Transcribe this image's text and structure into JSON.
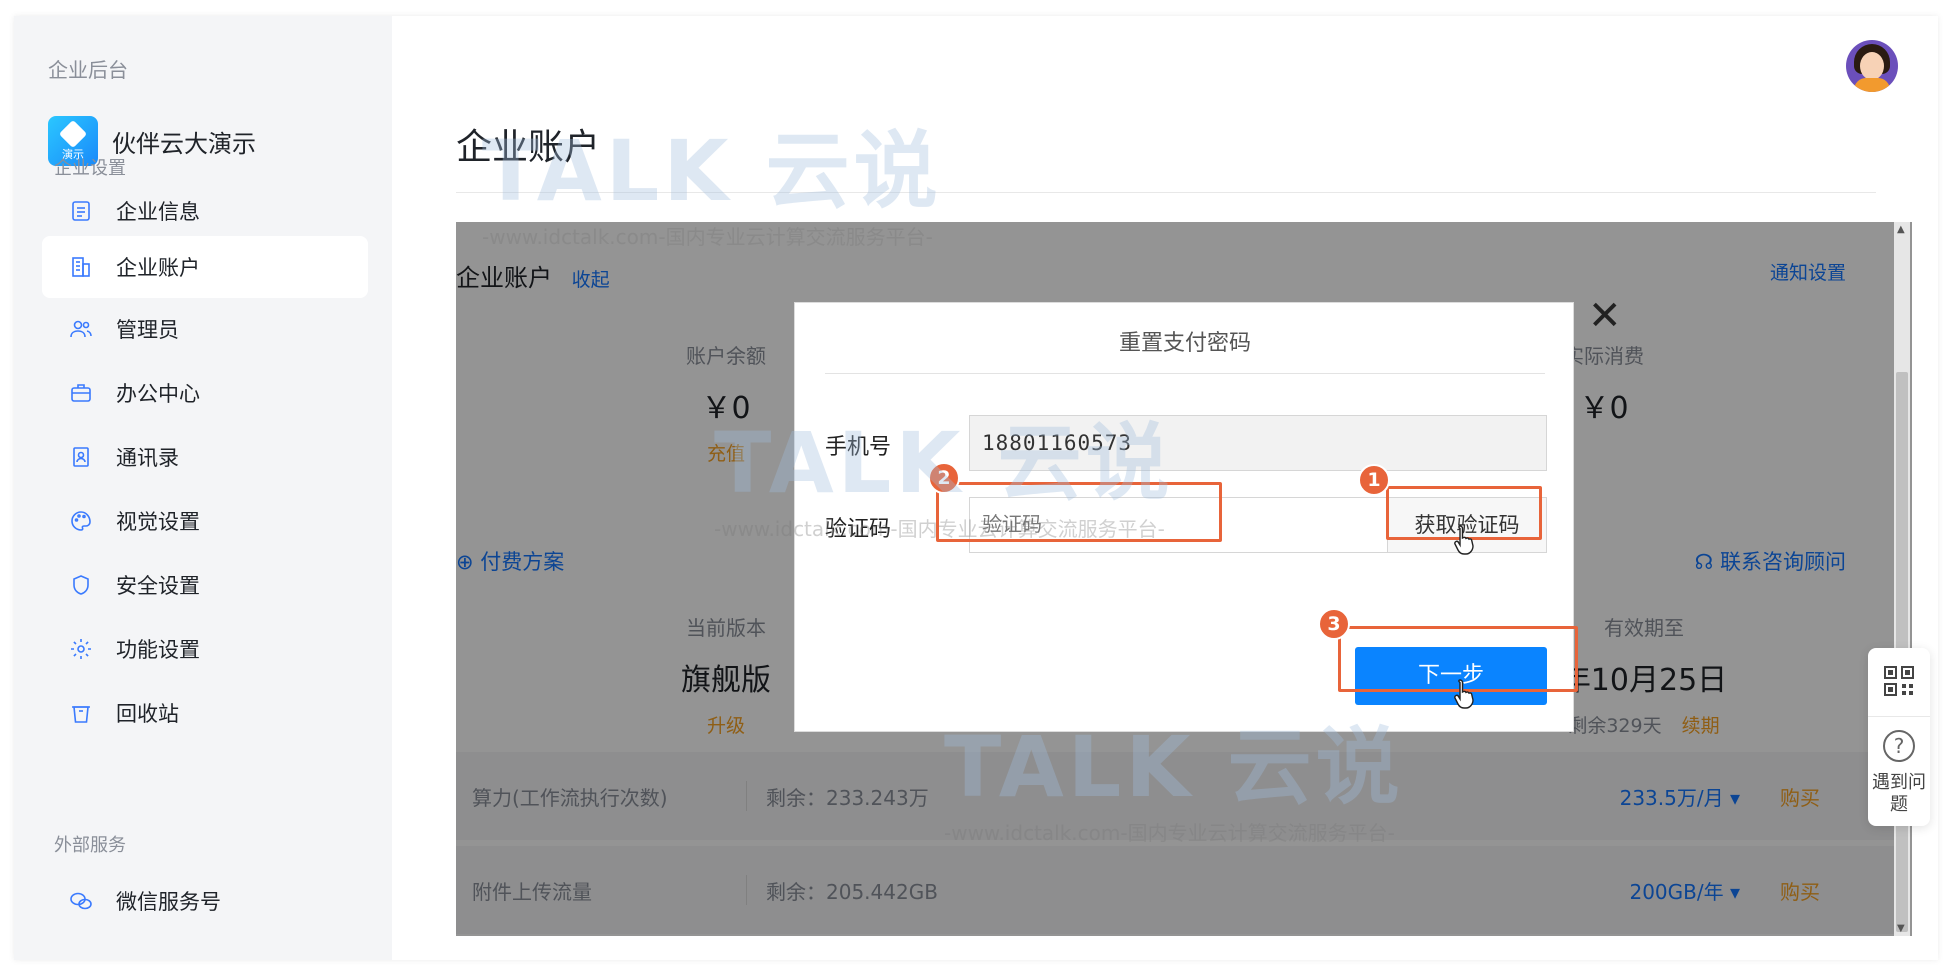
{
  "sidebar": {
    "caption": "企业后台",
    "org_name": "伙伴云大演示",
    "org_logo_tag": "演示",
    "section_settings": "企业设置",
    "section_external": "外部服务",
    "items": [
      {
        "label": "企业信息",
        "icon": "document-icon"
      },
      {
        "label": "企业账户",
        "icon": "building-icon"
      },
      {
        "label": "管理员",
        "icon": "users-icon"
      },
      {
        "label": "办公中心",
        "icon": "briefcase-icon"
      },
      {
        "label": "通讯录",
        "icon": "contacts-icon"
      },
      {
        "label": "视觉设置",
        "icon": "palette-icon"
      },
      {
        "label": "安全设置",
        "icon": "shield-icon"
      },
      {
        "label": "功能设置",
        "icon": "gear-icon"
      },
      {
        "label": "回收站",
        "icon": "trash-icon"
      },
      {
        "label": "微信服务号",
        "icon": "wechat-icon"
      }
    ]
  },
  "main": {
    "page_title": "企业账户",
    "section_title": "企业账户",
    "collapse_label": "收起",
    "notify_label": "通知设置",
    "stats": {
      "balance_label": "账户余额",
      "balance_value": "￥0",
      "recharge_label": "充值",
      "consume_label": "实际消费",
      "consume_value": "￥0"
    },
    "plan_label": "付费方案",
    "contact_label": "联系咨询顾问",
    "version": {
      "label": "当前版本",
      "value": "旗舰版",
      "upgrade": "升级",
      "expiry_label": "有效期至",
      "expiry_value": "年10月25日",
      "remaining": "剩余329天",
      "renew": "续期"
    },
    "rows": [
      {
        "name": "算力(工作流执行次数)",
        "remain": "剩余：233.243万",
        "quota": "233.5万/月 ▾",
        "buy": "购买"
      },
      {
        "name": "附件上传流量",
        "remain": "剩余：205.442GB",
        "quota": "200GB/年 ▾",
        "buy": "购买"
      }
    ]
  },
  "dialog": {
    "title": "重置支付密码",
    "phone_label": "手机号",
    "phone_value": "18801160573",
    "code_label": "验证码",
    "code_placeholder": "验证码",
    "get_code_label": "获取验证码",
    "next_label": "下一步",
    "close_glyph": "✕"
  },
  "annotations": {
    "step1": "1",
    "step2": "2",
    "step3": "3",
    "color": "#e8643a"
  },
  "float_tools": {
    "help_glyph": "?",
    "help_text": "遇到问题"
  },
  "watermark": {
    "logo": "TALK 云说",
    "url": "-www.idctalk.com-国内专业云计算交流服务平台-"
  },
  "colors": {
    "accent": "#1677ff",
    "primary_button": "#0a84ff",
    "warning": "#f7a325"
  }
}
